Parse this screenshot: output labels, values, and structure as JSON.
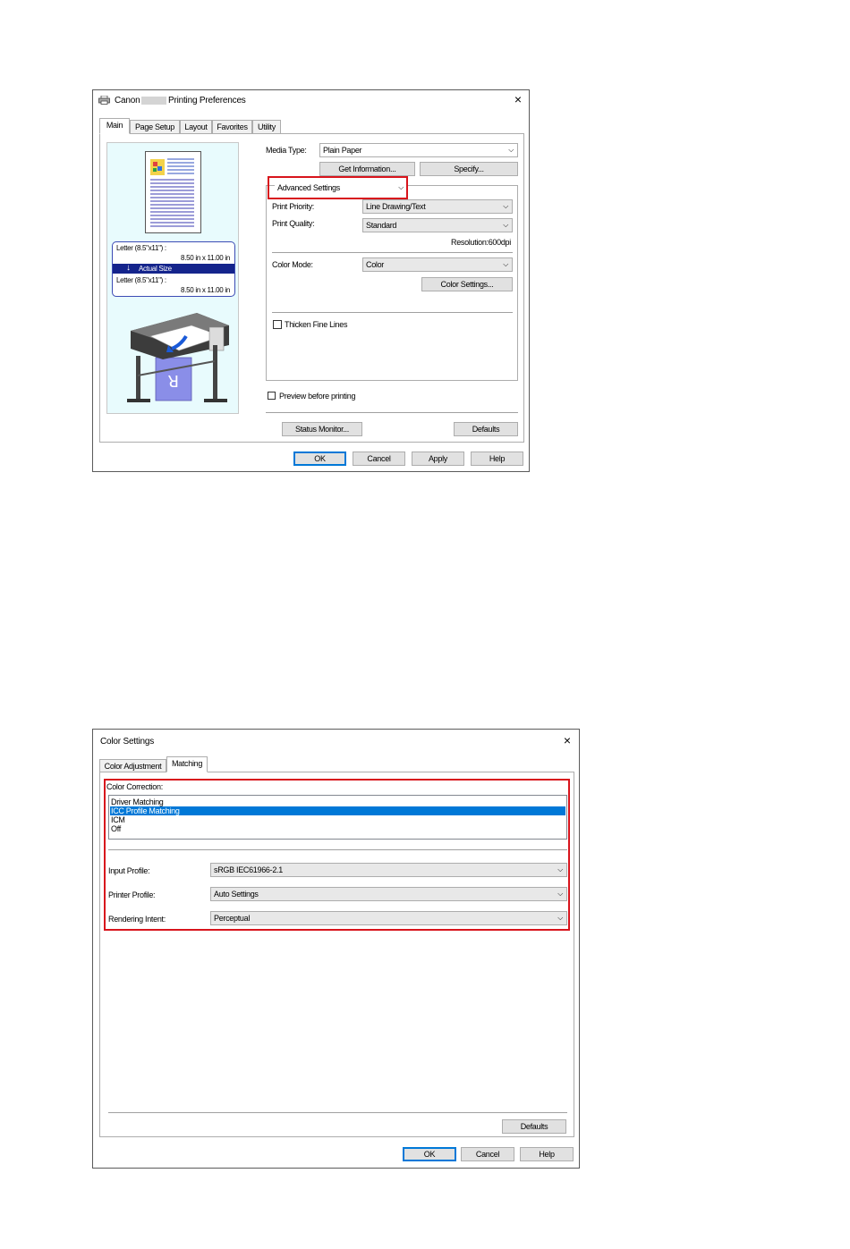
{
  "printing_prefs": {
    "title_prefix": "Canon",
    "title_suffix": "Printing Preferences",
    "close": "×",
    "tabs": [
      "Main",
      "Page Setup",
      "Layout",
      "Favorites",
      "Utility"
    ],
    "media_type_label": "Media Type:",
    "media_type_value": "Plain Paper",
    "get_information": "Get Information...",
    "specify": "Specify...",
    "advanced_settings": "Advanced Settings",
    "print_priority_label": "Print Priority:",
    "print_priority_value": "Line Drawing/Text",
    "print_quality_label": "Print Quality:",
    "print_quality_value": "Standard",
    "resolution": "Resolution:600dpi",
    "color_mode_label": "Color Mode:",
    "color_mode_value": "Color",
    "color_settings": "Color Settings...",
    "thicken_fine_lines": "Thicken Fine Lines",
    "preview_before_printing": "Preview before printing",
    "status_monitor": "Status Monitor...",
    "defaults": "Defaults",
    "ok": "OK",
    "cancel": "Cancel",
    "apply": "Apply",
    "help": "Help",
    "preview": {
      "paper1_name": "Letter (8.5\"x11\") :",
      "paper1_size": "8.50 in x 11.00 in",
      "actual_size": "Actual Size",
      "paper2_name": "Letter (8.5\"x11\") :",
      "paper2_size": "8.50 in x 11.00 in",
      "sample_letter": "R"
    }
  },
  "color_settings": {
    "title": "Color Settings",
    "close": "×",
    "tabs": [
      "Color Adjustment",
      "Matching"
    ],
    "color_correction_label": "Color Correction:",
    "color_correction_options": [
      "Driver Matching",
      "ICC Profile Matching",
      "ICM",
      "Off"
    ],
    "input_profile_label": "Input Profile:",
    "input_profile_value": "sRGB IEC61966-2.1",
    "printer_profile_label": "Printer Profile:",
    "printer_profile_value": "Auto Settings",
    "rendering_intent_label": "Rendering Intent:",
    "rendering_intent_value": "Perceptual",
    "defaults": "Defaults",
    "ok": "OK",
    "cancel": "Cancel",
    "help": "Help"
  },
  "colors": {
    "highlight": "#d8141c",
    "selection": "#0078d7",
    "preview_bg": "#e8fbfd"
  }
}
